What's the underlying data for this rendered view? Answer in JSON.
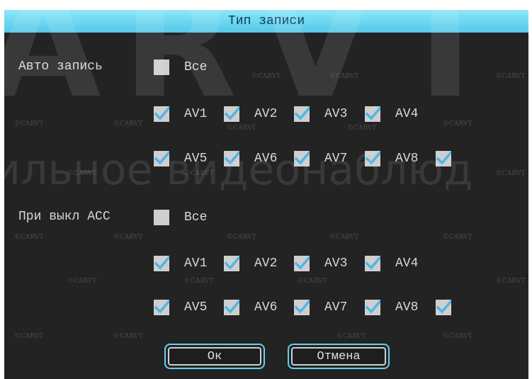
{
  "dialog": {
    "title": "Тип записи",
    "ok_label": "Ок",
    "cancel_label": "Отмена"
  },
  "auto_record": {
    "label": "Авто запись",
    "all_label": "Все",
    "all_checked": false,
    "channels": [
      {
        "label": "AV1",
        "checked": true
      },
      {
        "label": "AV2",
        "checked": true
      },
      {
        "label": "AV3",
        "checked": true
      },
      {
        "label": "AV4",
        "checked": true
      },
      {
        "label": "AV5",
        "checked": true
      },
      {
        "label": "AV6",
        "checked": true
      },
      {
        "label": "AV7",
        "checked": true
      },
      {
        "label": "AV8",
        "checked": true
      }
    ],
    "extra_checked": true
  },
  "acc_off_record": {
    "label": "При выкл ACC",
    "all_label": "Все",
    "all_checked": false,
    "channels": [
      {
        "label": "AV1",
        "checked": true
      },
      {
        "label": "AV2",
        "checked": true
      },
      {
        "label": "AV3",
        "checked": true
      },
      {
        "label": "AV4",
        "checked": true
      },
      {
        "label": "AV5",
        "checked": true
      },
      {
        "label": "AV6",
        "checked": true
      },
      {
        "label": "AV7",
        "checked": true
      },
      {
        "label": "AV8",
        "checked": true
      }
    ],
    "extra_checked": true
  },
  "watermark": {
    "big_text": "ARVT",
    "sub_text": "ильное видеонаблюд",
    "small_text": "©CARVT"
  },
  "colors": {
    "title_bar": "#6ad6f0",
    "background": "#232323",
    "checkmark": "#4fb6e6",
    "checkbox": "#cfcfcf",
    "button_border": "#5fd2ee"
  }
}
